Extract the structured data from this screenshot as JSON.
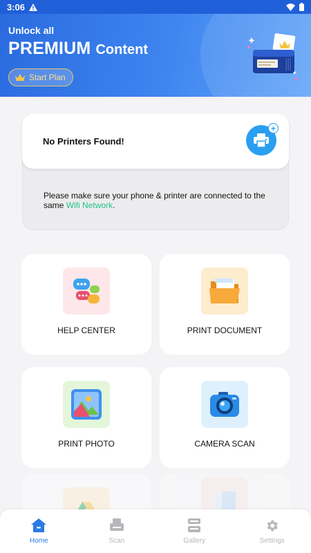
{
  "status_bar": {
    "time": "3:06"
  },
  "banner": {
    "line1": "Unlock all",
    "premium": "PREMIUM",
    "content": "Content",
    "start_plan": "Start Plan"
  },
  "printer_card": {
    "title": "No Printers Found!",
    "message_prefix": "Please make sure your phone & printer are connected to the same ",
    "message_link": "Wifi Network",
    "message_suffix": "."
  },
  "tiles": [
    {
      "label": "HELP CENTER",
      "icon": "chat-bubbles-icon",
      "bg": "#fde7ea"
    },
    {
      "label": "PRINT DOCUMENT",
      "icon": "folder-icon",
      "bg": "#fdeccd"
    },
    {
      "label": "PRINT PHOTO",
      "icon": "photo-icon",
      "bg": "#e3f6d9"
    },
    {
      "label": "CAMERA SCAN",
      "icon": "camera-icon",
      "bg": "#dff0fd"
    }
  ],
  "nav": [
    {
      "label": "Home",
      "icon": "home-icon",
      "active": true
    },
    {
      "label": "Scan",
      "icon": "scanner-icon",
      "active": false
    },
    {
      "label": "Gallery",
      "icon": "gallery-icon",
      "active": false
    },
    {
      "label": "Settings",
      "icon": "gear-icon",
      "active": false
    }
  ],
  "colors": {
    "accent": "#2a7be6",
    "link": "#22c38a",
    "banner": "#2a6be0"
  }
}
